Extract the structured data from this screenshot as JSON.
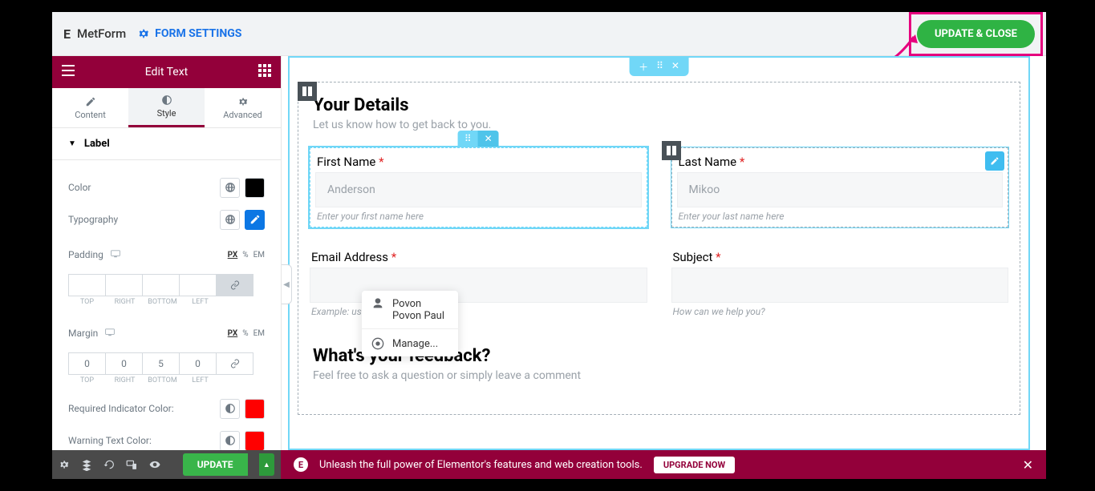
{
  "topbar": {
    "brand": "MetForm",
    "form_settings": "FORM SETTINGS",
    "update_close": "UPDATE & CLOSE"
  },
  "sidebar": {
    "title": "Edit Text",
    "tabs": {
      "content": "Content",
      "style": "Style",
      "advanced": "Advanced"
    },
    "section": "Label",
    "controls": {
      "color_label": "Color",
      "color_value": "#000000",
      "typography_label": "Typography",
      "padding_label": "Padding",
      "margin_label": "Margin",
      "units": {
        "px": "PX",
        "pct": "%",
        "em": "EM"
      },
      "dim_labels": {
        "top": "TOP",
        "right": "RIGHT",
        "bottom": "BOTTOM",
        "left": "LEFT"
      },
      "padding_vals": {
        "top": "",
        "right": "",
        "bottom": "",
        "left": ""
      },
      "margin_vals": {
        "top": "0",
        "right": "0",
        "bottom": "5",
        "left": "0"
      },
      "req_color_label": "Required Indicator Color:",
      "req_color_value": "#ff0000",
      "warn_color_label": "Warning Text Color:",
      "warn_color_value": "#ff0000"
    }
  },
  "form": {
    "heading": "Your Details",
    "sub": "Let us know how to get back to you.",
    "first_name": {
      "label": "First Name",
      "value": "Anderson",
      "help": "Enter your first name here"
    },
    "last_name": {
      "label": "Last Name",
      "value": "Mikoo",
      "help": "Enter your last name here"
    },
    "email": {
      "label": "Email Address",
      "help": "Example: user@website.com"
    },
    "subject": {
      "label": "Subject",
      "help": "How can we help you?"
    },
    "feedback_h": "What's your feedback?",
    "feedback_sub": "Feel free to ask a question or simply leave a comment"
  },
  "autofill": {
    "name": "Povon",
    "full": "Povon Paul",
    "manage": "Manage..."
  },
  "footer": {
    "update": "UPDATE",
    "promo": "Unleash the full power of Elementor's features and web creation tools.",
    "upgrade": "UPGRADE NOW"
  }
}
